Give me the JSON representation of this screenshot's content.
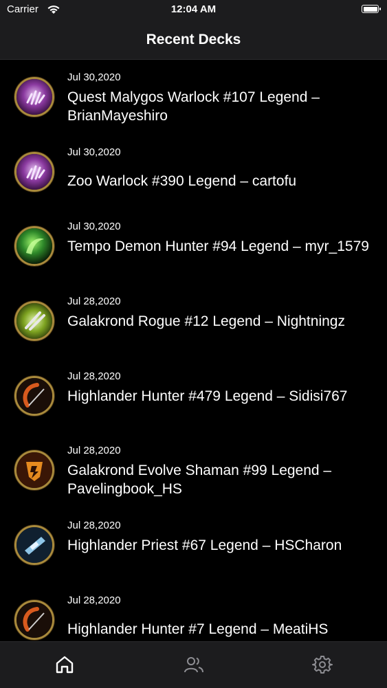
{
  "status": {
    "carrier": "Carrier",
    "time": "12:04 AM"
  },
  "nav": {
    "title": "Recent Decks"
  },
  "decks": [
    {
      "date": "Jul 30,2020",
      "title": "Quest Malygos Warlock #107 Legend – BrianMayeshiro",
      "icon": "warlock-class-icon"
    },
    {
      "date": "Jul 30,2020",
      "title": "Zoo Warlock #390 Legend – cartofu",
      "icon": "warlock-class-icon"
    },
    {
      "date": "Jul 30,2020",
      "title": "Tempo Demon Hunter #94 Legend – myr_1579",
      "icon": "demon-hunter-class-icon"
    },
    {
      "date": "Jul 28,2020",
      "title": "Galakrond Rogue #12 Legend – Nightningz",
      "icon": "rogue-class-icon"
    },
    {
      "date": "Jul 28,2020",
      "title": "Highlander Hunter #479 Legend – Sidisi767",
      "icon": "hunter-class-icon"
    },
    {
      "date": "Jul 28,2020",
      "title": "Galakrond Evolve Shaman #99 Legend – Pavelingbook_HS",
      "icon": "shaman-class-icon"
    },
    {
      "date": "Jul 28,2020",
      "title": "Highlander Priest #67 Legend – HSCharon",
      "icon": "priest-class-icon"
    },
    {
      "date": "Jul 28,2020",
      "title": "Highlander Hunter #7 Legend – MeatiHS",
      "icon": "hunter-class-icon"
    }
  ],
  "tabs": [
    {
      "name": "home",
      "icon": "home-icon",
      "active": true
    },
    {
      "name": "people",
      "icon": "people-icon",
      "active": false
    },
    {
      "name": "settings",
      "icon": "gear-icon",
      "active": false
    }
  ],
  "colors": {
    "accent": "#ffffff",
    "inactive": "#8e8e93",
    "bar": "#1c1c1e",
    "avatar_ring": "#a98a3c"
  }
}
